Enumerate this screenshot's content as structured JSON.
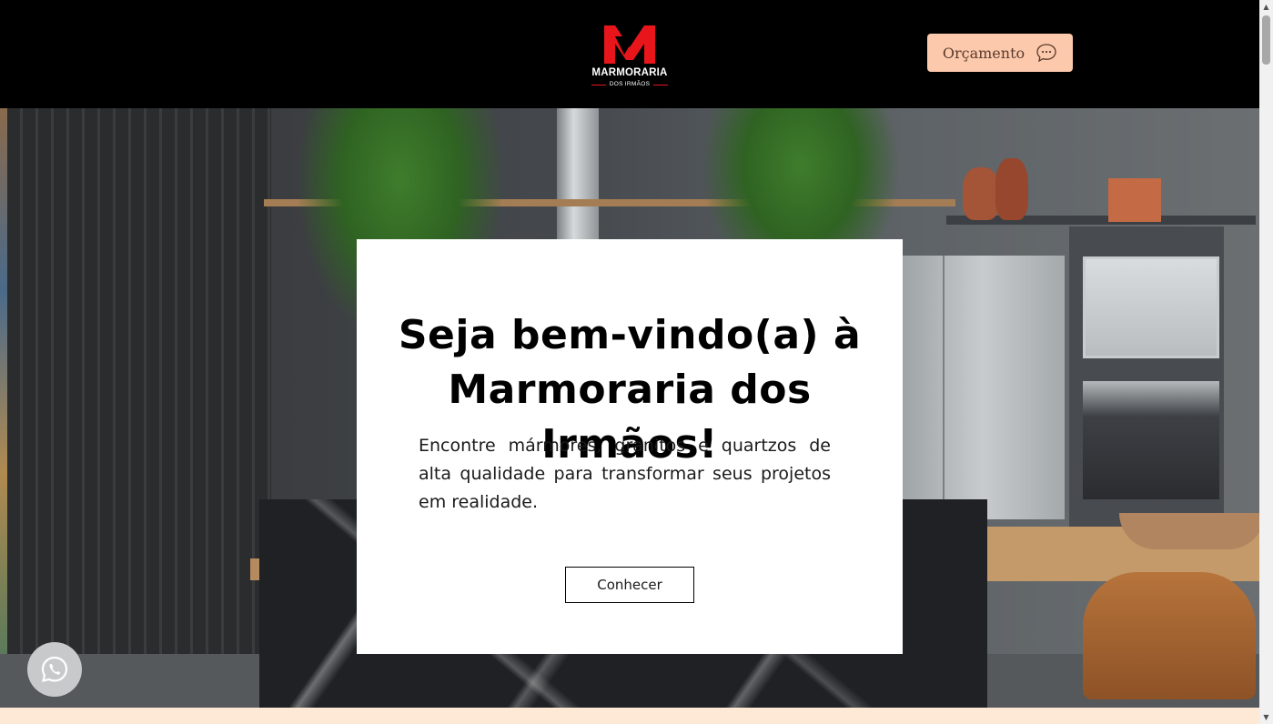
{
  "header": {
    "logo": {
      "title": "MARMORARIA",
      "subtitle": "DOS IRMÃOS",
      "mark_letter": "M",
      "brand_color": "#e8161b"
    },
    "quote_button": {
      "label": "Orçamento",
      "icon": "chat-bubble-icon",
      "bg_color": "#fcc9ad"
    }
  },
  "hero": {
    "background": "kitchen-photo",
    "card": {
      "title": "Seja bem-vindo(a) à Marmoraria dos Irmãos!",
      "description": "Encontre mármores, granitos e quartzos de alta qualidade para transformar seus projetos em realidade.",
      "cta_label": "Conhecer"
    }
  },
  "floating": {
    "whatsapp_icon": "whatsapp-icon"
  },
  "colors": {
    "header_bg": "#000000",
    "band_bg": "#fde9d5"
  }
}
